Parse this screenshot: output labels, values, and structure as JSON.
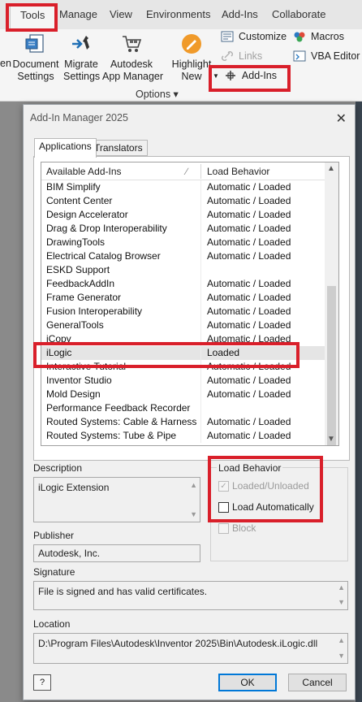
{
  "ribbon": {
    "tabs": [
      {
        "label": "Tools",
        "active": true
      },
      {
        "label": "Manage"
      },
      {
        "label": "View"
      },
      {
        "label": "Environments"
      },
      {
        "label": "Add-Ins"
      },
      {
        "label": "Collaborate"
      }
    ],
    "open_label": "en",
    "buttons": {
      "document_settings": [
        "Document",
        "Settings"
      ],
      "migrate_settings": [
        "Migrate",
        "Settings"
      ],
      "app_manager": [
        "Autodesk",
        "App Manager"
      ],
      "highlight_new": [
        "Highlight",
        "New"
      ]
    },
    "small_buttons": {
      "customize": "Customize",
      "links": "Links",
      "add_ins": "Add-Ins",
      "macros": "Macros",
      "vba_editor": "VBA Editor"
    },
    "panel_label": "Options ▾"
  },
  "dialog": {
    "title": "Add-In Manager 2025",
    "tabs": [
      "Applications",
      "Translators"
    ],
    "list": {
      "headers": {
        "name": "Available Add-Ins",
        "behavior": "Load Behavior"
      },
      "rows": [
        {
          "name": "BIM Simplify",
          "behavior": "Automatic / Loaded"
        },
        {
          "name": "Content Center",
          "behavior": "Automatic / Loaded"
        },
        {
          "name": "Design Accelerator",
          "behavior": "Automatic / Loaded"
        },
        {
          "name": "Drag & Drop Interoperability",
          "behavior": "Automatic / Loaded"
        },
        {
          "name": "DrawingTools",
          "behavior": "Automatic / Loaded"
        },
        {
          "name": "Electrical Catalog Browser",
          "behavior": "Automatic / Loaded"
        },
        {
          "name": "ESKD Support",
          "behavior": ""
        },
        {
          "name": "FeedbackAddIn",
          "behavior": "Automatic / Loaded"
        },
        {
          "name": "Frame Generator",
          "behavior": "Automatic / Loaded"
        },
        {
          "name": "Fusion Interoperability",
          "behavior": "Automatic / Loaded"
        },
        {
          "name": "GeneralTools",
          "behavior": "Automatic / Loaded"
        },
        {
          "name": "iCopy",
          "behavior": "Automatic / Loaded"
        },
        {
          "name": "iLogic",
          "behavior": "Loaded",
          "selected": true
        },
        {
          "name": "Interactive Tutorial",
          "behavior": "Automatic / Loaded"
        },
        {
          "name": "Inventor Studio",
          "behavior": "Automatic / Loaded"
        },
        {
          "name": "Mold Design",
          "behavior": "Automatic / Loaded"
        },
        {
          "name": "Performance Feedback Recorder",
          "behavior": ""
        },
        {
          "name": "Routed Systems: Cable & Harness",
          "behavior": "Automatic / Loaded"
        },
        {
          "name": "Routed Systems: Tube & Pipe",
          "behavior": "Automatic / Loaded"
        }
      ]
    },
    "description": {
      "label": "Description",
      "value": "iLogic Extension"
    },
    "load_behavior": {
      "label": "Load Behavior",
      "loaded_unloaded": "Loaded/Unloaded",
      "load_automatically": "Load Automatically",
      "block": "Block"
    },
    "publisher": {
      "label": "Publisher",
      "value": "Autodesk, Inc."
    },
    "signature": {
      "label": "Signature",
      "value": "File is signed and has valid certificates."
    },
    "location": {
      "label": "Location",
      "value": "D:\\Program Files\\Autodesk\\Inventor 2025\\Bin\\Autodesk.iLogic.dll"
    },
    "buttons": {
      "ok": "OK",
      "cancel": "Cancel",
      "help": "?"
    }
  },
  "colors": {
    "highlight": "#d91f2a",
    "accent": "#0078d7"
  }
}
